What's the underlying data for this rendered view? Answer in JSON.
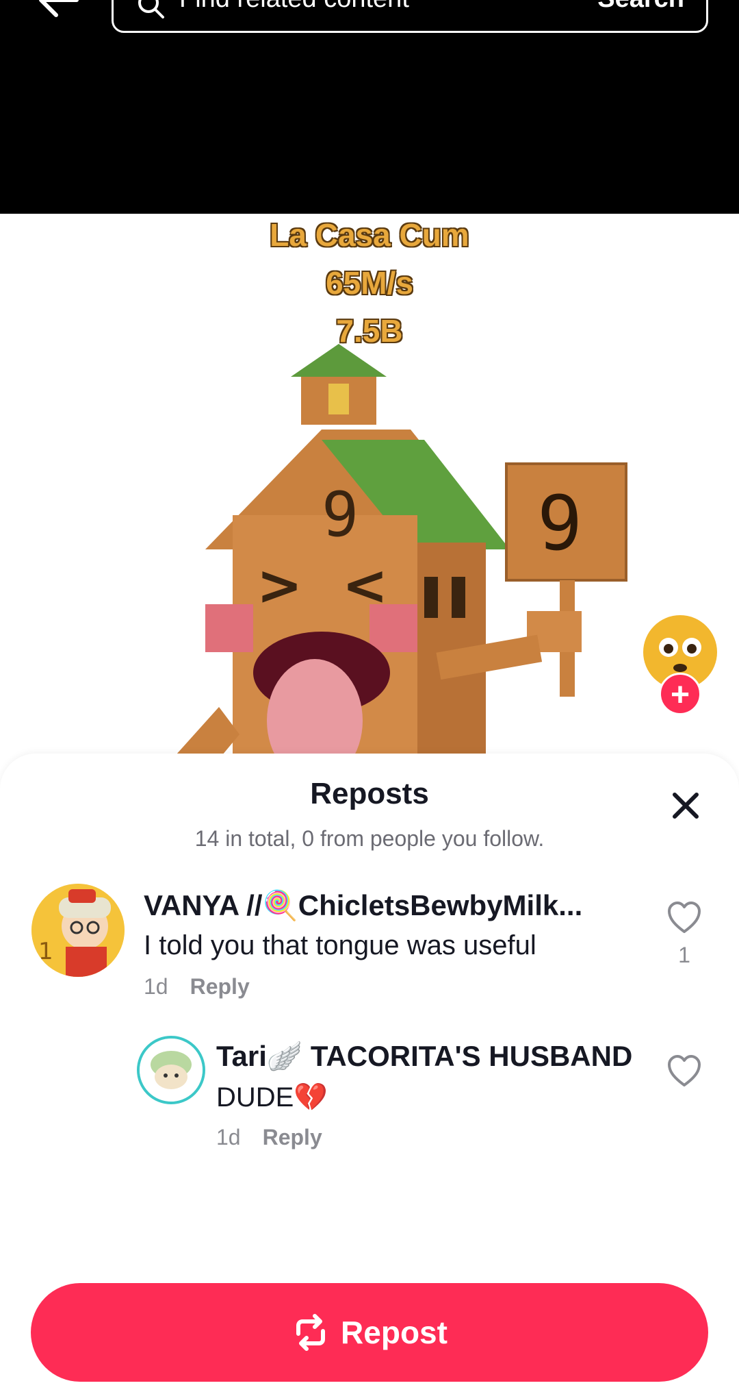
{
  "search": {
    "placeholder": "Find related content",
    "button": "Search"
  },
  "video": {
    "overlay": [
      "La Casa Cum",
      "65M/s",
      "7.5B"
    ]
  },
  "sheet": {
    "title": "Reposts",
    "subtitle": "14 in total, 0 from people you follow."
  },
  "comments": [
    {
      "username": "VANYA //🍭ChicletsBewbyMilk...",
      "text": "I told you that tongue was useful",
      "time": "1d",
      "reply": "Reply",
      "likes": "1"
    },
    {
      "username": "Tari🪽 TACORITA'S HUSBAND",
      "text": "DUDE💔",
      "time": "1d",
      "reply": "Reply"
    }
  ],
  "repost_button": "Repost",
  "colors": {
    "accent": "#fe2c55"
  }
}
